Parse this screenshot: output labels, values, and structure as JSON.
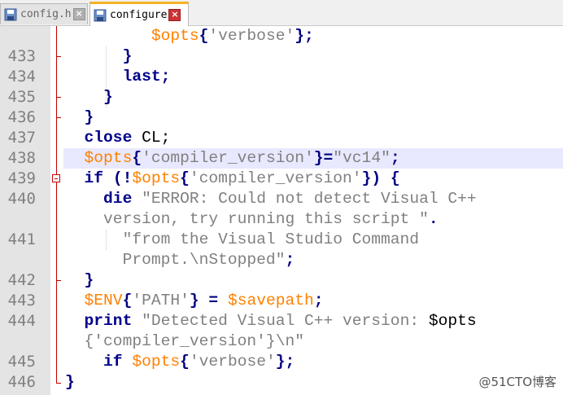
{
  "tabs": [
    {
      "label": "config.h",
      "active": false
    },
    {
      "label": "configure",
      "active": true
    }
  ],
  "lines": [
    {
      "num": "",
      "tokens": [
        {
          "t": "         ",
          "c": "pl"
        },
        {
          "t": "$opts",
          "c": "var"
        },
        {
          "t": "{",
          "c": "brace"
        },
        {
          "t": "'verbose'",
          "c": "str"
        },
        {
          "t": "};",
          "c": "brace"
        }
      ]
    },
    {
      "num": "433",
      "tokens": [
        {
          "t": "      ",
          "c": "pl"
        },
        {
          "t": "}",
          "c": "brace"
        }
      ]
    },
    {
      "num": "434",
      "tokens": [
        {
          "t": "      ",
          "c": "pl"
        },
        {
          "t": "last",
          "c": "kw"
        },
        {
          "t": ";",
          "c": "brace"
        }
      ]
    },
    {
      "num": "435",
      "tokens": [
        {
          "t": "    ",
          "c": "pl"
        },
        {
          "t": "}",
          "c": "brace"
        }
      ]
    },
    {
      "num": "436",
      "tokens": [
        {
          "t": "  ",
          "c": "pl"
        },
        {
          "t": "}",
          "c": "brace"
        }
      ]
    },
    {
      "num": "437",
      "tokens": [
        {
          "t": "  ",
          "c": "pl"
        },
        {
          "t": "close",
          "c": "kw"
        },
        {
          "t": " CL;",
          "c": "pl"
        }
      ]
    },
    {
      "num": "438",
      "tokens": [
        {
          "t": "  ",
          "c": "pl"
        },
        {
          "t": "$opts",
          "c": "var"
        },
        {
          "t": "{",
          "c": "brace"
        },
        {
          "t": "'compiler_version'",
          "c": "str"
        },
        {
          "t": "}=",
          "c": "brace"
        },
        {
          "t": "\"vc14\"",
          "c": "str"
        },
        {
          "t": ";",
          "c": "brace"
        }
      ],
      "highlight": true
    },
    {
      "num": "439",
      "tokens": [
        {
          "t": "  ",
          "c": "pl"
        },
        {
          "t": "if",
          "c": "kw"
        },
        {
          "t": " (!",
          "c": "brace"
        },
        {
          "t": "$opts",
          "c": "var"
        },
        {
          "t": "{",
          "c": "brace"
        },
        {
          "t": "'compiler_version'",
          "c": "str"
        },
        {
          "t": "}) {",
          "c": "brace"
        }
      ]
    },
    {
      "num": "440",
      "tokens": [
        {
          "t": "    ",
          "c": "pl"
        },
        {
          "t": "die",
          "c": "kw"
        },
        {
          "t": " ",
          "c": "pl"
        },
        {
          "t": "\"ERROR: Could not detect Visual C++",
          "c": "str"
        }
      ]
    },
    {
      "num": "",
      "tokens": [
        {
          "t": "    ",
          "c": "pl"
        },
        {
          "t": "version, try running this script \"",
          "c": "str"
        },
        {
          "t": ".",
          "c": "brace"
        }
      ]
    },
    {
      "num": "441",
      "tokens": [
        {
          "t": "      ",
          "c": "pl"
        },
        {
          "t": "\"from the Visual Studio Command",
          "c": "str"
        }
      ]
    },
    {
      "num": "",
      "tokens": [
        {
          "t": "      ",
          "c": "pl"
        },
        {
          "t": "Prompt.\\nStopped\"",
          "c": "str"
        },
        {
          "t": ";",
          "c": "brace"
        }
      ]
    },
    {
      "num": "442",
      "tokens": [
        {
          "t": "  ",
          "c": "pl"
        },
        {
          "t": "}",
          "c": "brace"
        }
      ]
    },
    {
      "num": "443",
      "tokens": [
        {
          "t": "  ",
          "c": "pl"
        },
        {
          "t": "$ENV",
          "c": "var"
        },
        {
          "t": "{",
          "c": "brace"
        },
        {
          "t": "'PATH'",
          "c": "str"
        },
        {
          "t": "} = ",
          "c": "brace"
        },
        {
          "t": "$savepath",
          "c": "var"
        },
        {
          "t": ";",
          "c": "brace"
        }
      ]
    },
    {
      "num": "444",
      "tokens": [
        {
          "t": "  ",
          "c": "pl"
        },
        {
          "t": "print",
          "c": "kw"
        },
        {
          "t": " ",
          "c": "pl"
        },
        {
          "t": "\"Detected Visual C++ version: ",
          "c": "str"
        },
        {
          "t": "$opts",
          "c": "pl"
        }
      ]
    },
    {
      "num": "",
      "tokens": [
        {
          "t": "  ",
          "c": "pl"
        },
        {
          "t": "{'compiler_version'}\\n\"",
          "c": "str"
        }
      ]
    },
    {
      "num": "445",
      "tokens": [
        {
          "t": "    ",
          "c": "pl"
        },
        {
          "t": "if",
          "c": "kw"
        },
        {
          "t": " ",
          "c": "pl"
        },
        {
          "t": "$opts",
          "c": "var"
        },
        {
          "t": "{",
          "c": "brace"
        },
        {
          "t": "'verbose'",
          "c": "str"
        },
        {
          "t": "};",
          "c": "brace"
        }
      ]
    },
    {
      "num": "446",
      "tokens": [
        {
          "t": "}",
          "c": "brace"
        }
      ]
    }
  ],
  "watermark": "@51CTO博客",
  "colors": {
    "keyword": "#00008b",
    "variable": "#ff8000",
    "string": "#808080",
    "highlight_line": "#e8e8ff",
    "gutter": "#e4e4e4",
    "fold_marker": "#c00000",
    "active_tab_accent": "#f5b225"
  }
}
